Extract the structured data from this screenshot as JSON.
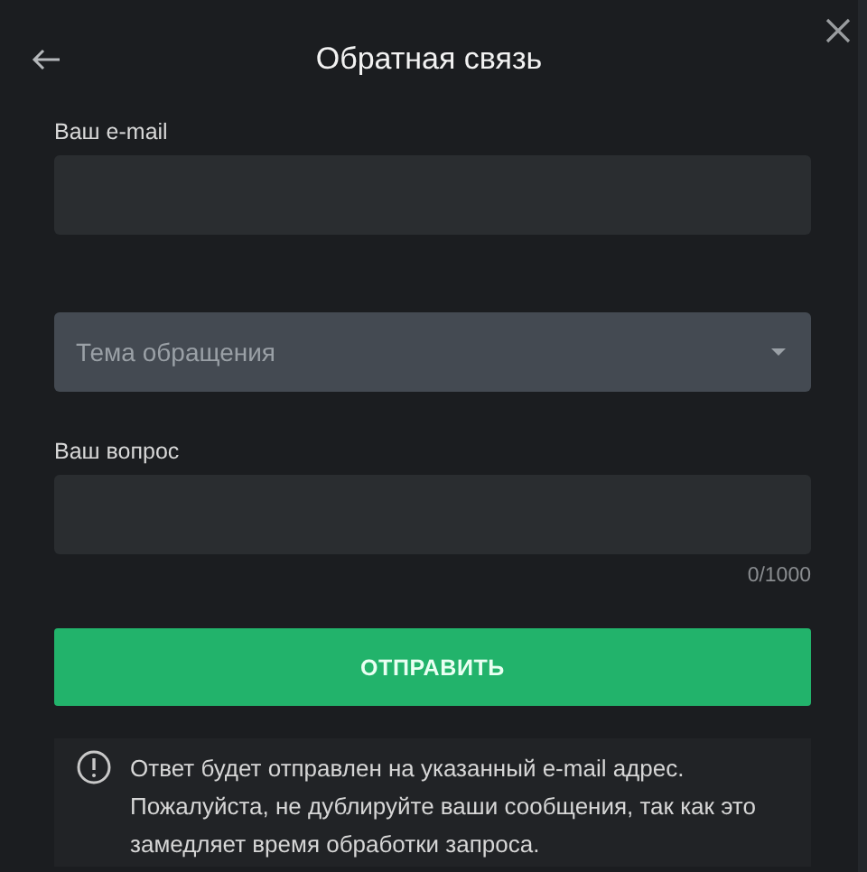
{
  "header": {
    "title": "Обратная связь"
  },
  "email": {
    "label": "Ваш e-mail"
  },
  "topic": {
    "placeholder": "Тема обращения"
  },
  "question": {
    "label": "Ваш вопрос",
    "counter": "0/1000"
  },
  "submit": {
    "label": "ОТПРАВИТЬ"
  },
  "notice": {
    "text": "Ответ будет отправлен на указанный e-mail адрес. Пожалуйста, не дублируйте ваши сообщения, так как это замедляет время обработки запроса."
  }
}
